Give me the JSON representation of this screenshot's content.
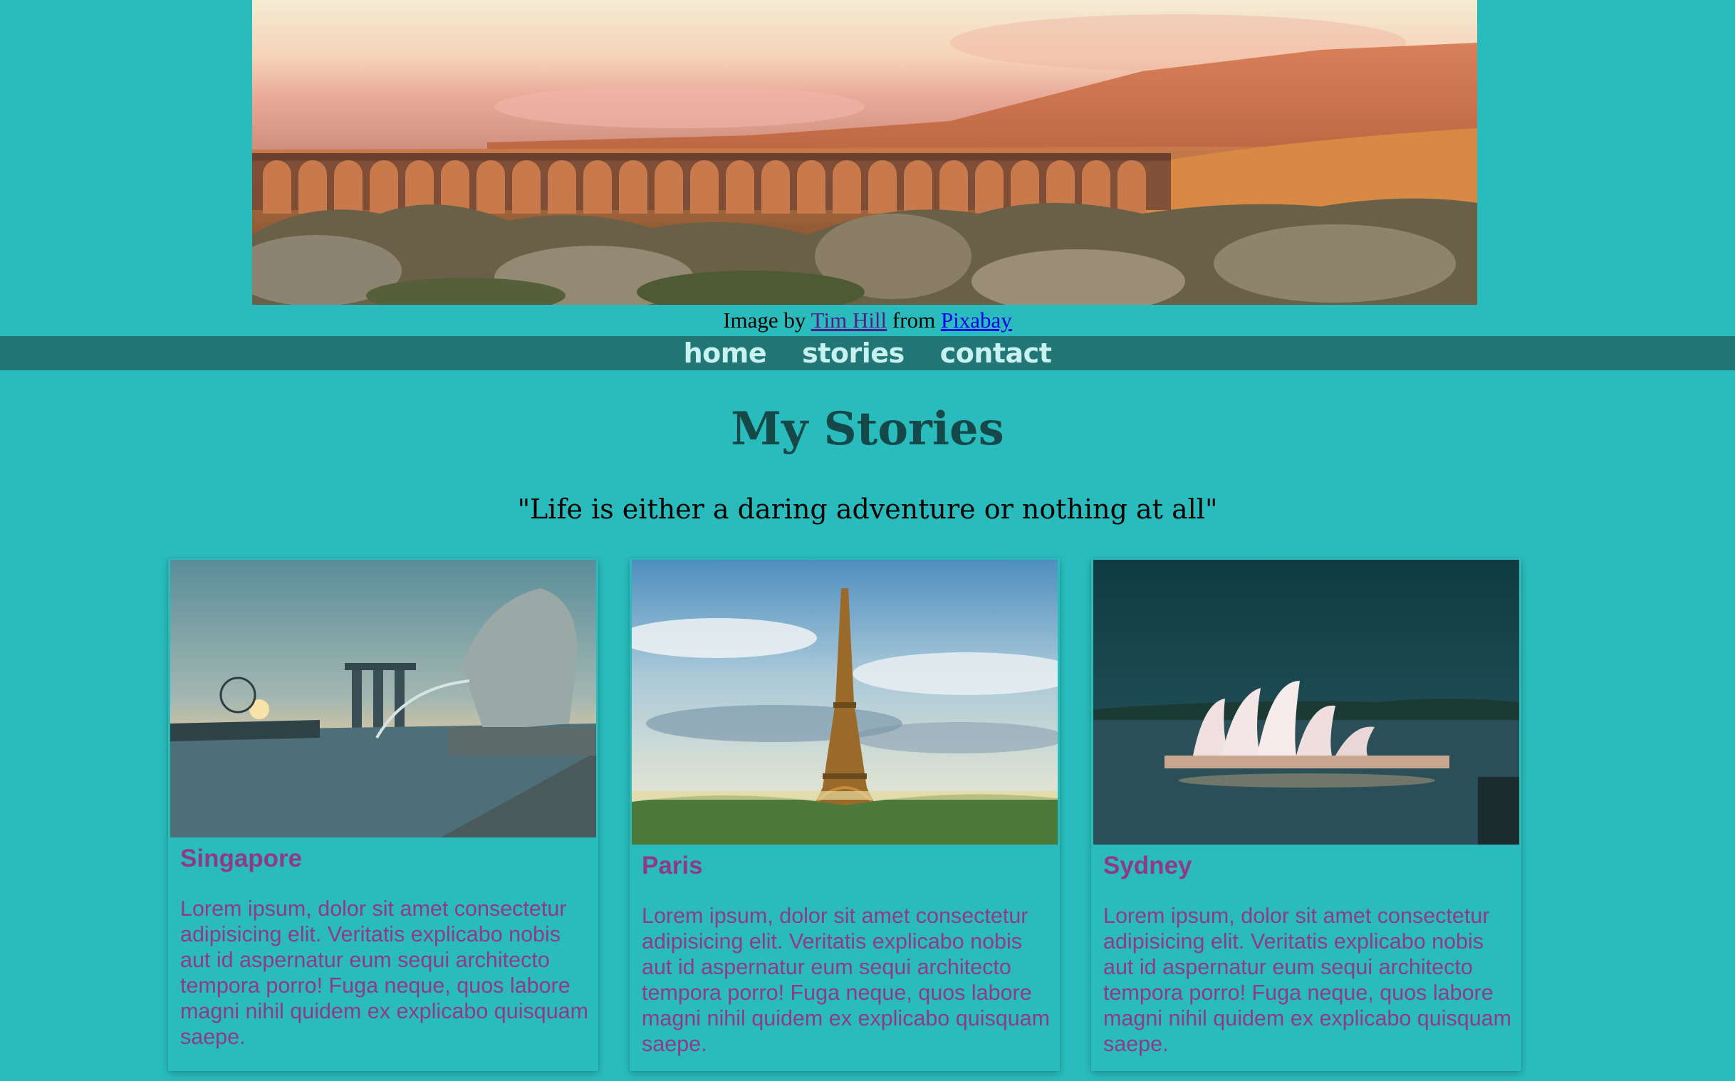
{
  "hero": {
    "credit_prefix": "Image by",
    "credit_author": "Tim Hill",
    "credit_middle": "from",
    "credit_source": "Pixabay"
  },
  "nav": {
    "items": [
      {
        "label": "home"
      },
      {
        "label": "stories"
      },
      {
        "label": "contact"
      }
    ]
  },
  "main": {
    "title": "My Stories",
    "quote": "\"Life is either a daring adventure or nothing at all\""
  },
  "cards": [
    {
      "title": "Singapore",
      "body": "Lorem ipsum, dolor sit amet consectetur adipisicing elit. Veritatis explicabo nobis aut id aspernatur eum sequi architecto tempora porro! Fuga neque, quos labore magni nihil quidem ex explicabo quisquam saepe."
    },
    {
      "title": "Paris",
      "body": "Lorem ipsum, dolor sit amet consectetur adipisicing elit. Veritatis explicabo nobis aut id aspernatur eum sequi architecto tempora porro! Fuga neque, quos labore magni nihil quidem ex explicabo quisquam saepe."
    },
    {
      "title": "Sydney",
      "body": "Lorem ipsum, dolor sit amet consectetur adipisicing elit. Veritatis explicabo nobis aut id aspernatur eum sequi architecto tempora porro! Fuga neque, quos labore magni nihil quidem ex explicabo quisquam saepe."
    }
  ],
  "colors": {
    "page_background": "#2abcbc",
    "nav_background": "#237676",
    "nav_text": "#c8f1f1",
    "title": "#154848",
    "card_text": "#8e3b86"
  }
}
